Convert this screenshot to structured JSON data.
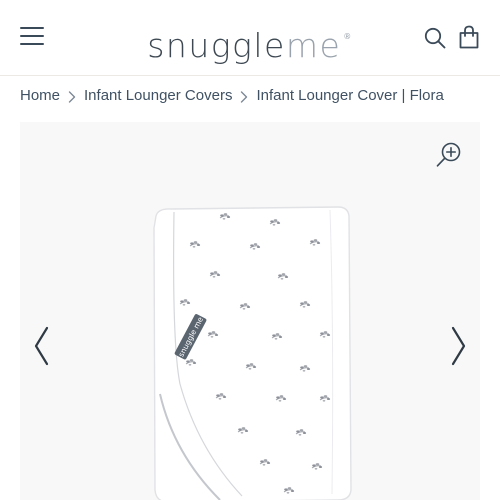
{
  "header": {
    "logo_part1": "snuggle",
    "logo_part2": "me",
    "logo_reg": "®",
    "icons": {
      "menu": "hamburger-menu-icon",
      "search": "search-icon",
      "bag": "shopping-bag-icon"
    }
  },
  "breadcrumb": {
    "items": [
      "Home",
      "Infant Lounger Covers",
      "Infant Lounger Cover | Flora"
    ],
    "separator_icon": "chevron-right-icon"
  },
  "gallery": {
    "zoom_icon": "zoom-in-icon",
    "prev_icon": "chevron-left-icon",
    "next_icon": "chevron-right-icon",
    "product_image": "folded-white-lounger-cover-with-grey-floral-print",
    "tag_text": "snuggle me"
  },
  "colors": {
    "text": "#3b4a58",
    "logo_dark": "#3d4852",
    "logo_light": "#9aa3ad",
    "gallery_bg": "#f8f8f8"
  }
}
